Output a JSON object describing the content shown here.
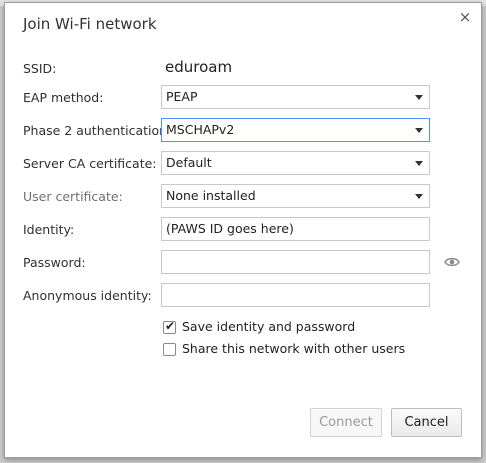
{
  "dialog": {
    "title": "Join Wi-Fi network",
    "close_symbol": "×"
  },
  "fields": {
    "ssid_label": "SSID:",
    "ssid_value": "eduroam",
    "eap_label": "EAP method:",
    "eap_value": "PEAP",
    "phase2_label": "Phase 2 authentication:",
    "phase2_value": "MSCHAPv2",
    "ca_label": "Server CA certificate:",
    "ca_value": "Default",
    "usercert_label": "User certificate:",
    "usercert_value": "None installed",
    "identity_label": "Identity:",
    "identity_value": "(PAWS ID goes here)",
    "password_label": "Password:",
    "password_value": "",
    "anon_label": "Anonymous identity:",
    "anon_value": ""
  },
  "checkboxes": {
    "save_label": "Save identity and password",
    "save_checked": true,
    "share_label": "Share this network with other users",
    "share_checked": false
  },
  "buttons": {
    "connect": "Connect",
    "cancel": "Cancel"
  },
  "icons": {
    "close": "close-icon",
    "eye": "eye-icon",
    "dropdown": "chevron-down-icon",
    "checkmark": "checkmark-icon"
  },
  "colors": {
    "focus_border": "#4d90fe",
    "disabled_text": "#9a9a9a"
  }
}
